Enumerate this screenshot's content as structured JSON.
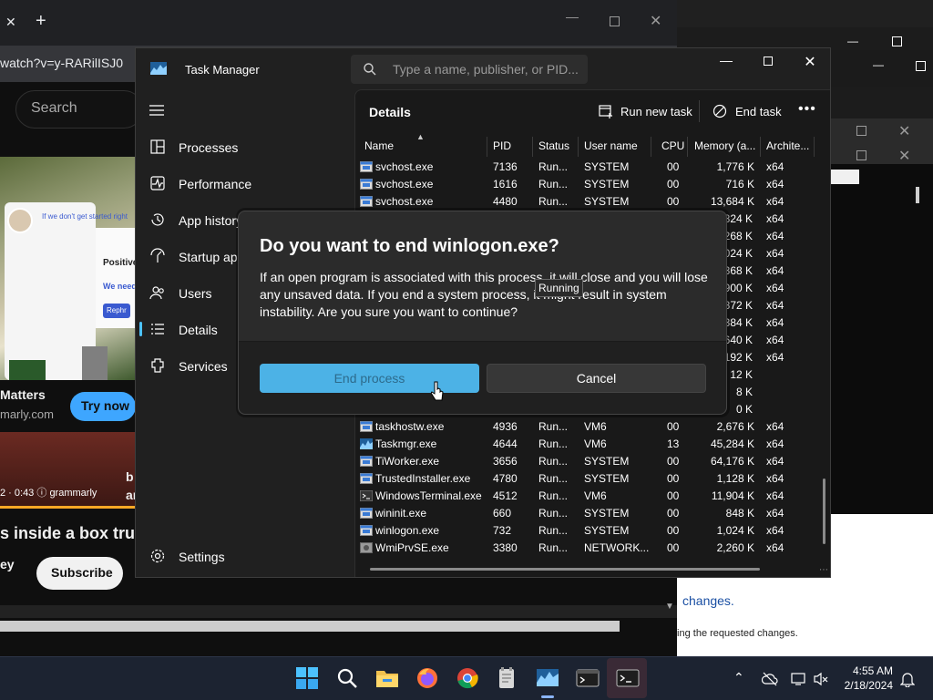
{
  "browser": {
    "new_tab_icon": "plus-icon",
    "url_fragment": "watch?v=y-RARilISJ0",
    "search_placeholder": "Search",
    "ad": {
      "card_text_1": "If we don't get started right",
      "card_text_2": "Positive",
      "card_text_3": "We need",
      "card_chip": "Rephr",
      "title": "Matters",
      "domain": "marly.com",
      "cta": "Try now",
      "time": "2 · 0:43",
      "advertiser": "grammarly",
      "overlay": "b\nar"
    },
    "video_title": "s inside a box tru",
    "channel": "ey",
    "subscribe": "Subscribe"
  },
  "update_panel": {
    "changes_link": "changes.",
    "description": "Windows needs to reboot your PC to finish installing the requested changes."
  },
  "task_manager": {
    "title": "Task Manager",
    "search_placeholder": "Type a name, publisher, or PID...",
    "nav": [
      {
        "label": "Processes",
        "icon": "processes-icon"
      },
      {
        "label": "Performance",
        "icon": "performance-icon"
      },
      {
        "label": "App history",
        "icon": "app-history-icon"
      },
      {
        "label": "Startup apps",
        "icon": "startup-apps-icon"
      },
      {
        "label": "Users",
        "icon": "users-icon"
      },
      {
        "label": "Details",
        "icon": "details-icon"
      },
      {
        "label": "Services",
        "icon": "services-icon"
      }
    ],
    "settings_label": "Settings",
    "page_title": "Details",
    "run_new_task": "Run new task",
    "end_task": "End task",
    "more": "•••",
    "columns": {
      "name": "Name",
      "pid": "PID",
      "status": "Status",
      "user": "User name",
      "cpu": "CPU",
      "memory": "Memory (a...",
      "arch": "Archite..."
    },
    "rows_top": [
      {
        "name": "svchost.exe",
        "pid": "7136",
        "status": "Run...",
        "user": "SYSTEM",
        "cpu": "00",
        "memory": "1,776 K",
        "arch": "x64"
      },
      {
        "name": "svchost.exe",
        "pid": "1616",
        "status": "Run...",
        "user": "SYSTEM",
        "cpu": "00",
        "memory": "716 K",
        "arch": "x64"
      },
      {
        "name": "svchost.exe",
        "pid": "4480",
        "status": "Run...",
        "user": "SYSTEM",
        "cpu": "00",
        "memory": "13,684 K",
        "arch": "x64"
      }
    ],
    "rows_partial": [
      {
        "memory": "824 K",
        "arch": "x64"
      },
      {
        "memory": "268 K",
        "arch": "x64"
      },
      {
        "memory": "024 K",
        "arch": "x64"
      },
      {
        "memory": "368 K",
        "arch": "x64"
      },
      {
        "memory": "900 K",
        "arch": "x64"
      },
      {
        "memory": "872 K",
        "arch": "x64"
      },
      {
        "memory": "384 K",
        "arch": "x64"
      },
      {
        "memory": "640 K",
        "arch": "x64"
      },
      {
        "memory": "192 K",
        "arch": "x64"
      },
      {
        "memory": "12 K",
        "arch": ""
      },
      {
        "memory": "8 K",
        "arch": ""
      },
      {
        "memory": "0 K",
        "arch": ""
      }
    ],
    "rows_bottom": [
      {
        "name": "taskhostw.exe",
        "pid": "4936",
        "status": "Run...",
        "user": "VM6",
        "cpu": "00",
        "memory": "2,676 K",
        "arch": "x64",
        "icon": "window-app-icon"
      },
      {
        "name": "Taskmgr.exe",
        "pid": "4644",
        "status": "Run...",
        "user": "VM6",
        "cpu": "13",
        "memory": "45,284 K",
        "arch": "x64",
        "icon": "task-manager-icon"
      },
      {
        "name": "TiWorker.exe",
        "pid": "3656",
        "status": "Run...",
        "user": "SYSTEM",
        "cpu": "00",
        "memory": "64,176 K",
        "arch": "x64",
        "icon": "window-app-icon"
      },
      {
        "name": "TrustedInstaller.exe",
        "pid": "4780",
        "status": "Run...",
        "user": "SYSTEM",
        "cpu": "00",
        "memory": "1,128 K",
        "arch": "x64",
        "icon": "window-app-icon"
      },
      {
        "name": "WindowsTerminal.exe",
        "pid": "4512",
        "status": "Run...",
        "user": "VM6",
        "cpu": "00",
        "memory": "11,904 K",
        "arch": "x64",
        "icon": "terminal-icon"
      },
      {
        "name": "wininit.exe",
        "pid": "660",
        "status": "Run...",
        "user": "SYSTEM",
        "cpu": "00",
        "memory": "848 K",
        "arch": "x64",
        "icon": "window-app-icon"
      },
      {
        "name": "winlogon.exe",
        "pid": "732",
        "status": "Run...",
        "user": "SYSTEM",
        "cpu": "00",
        "memory": "1,024 K",
        "arch": "x64",
        "icon": "window-app-icon"
      },
      {
        "name": "WmiPrvSE.exe",
        "pid": "3380",
        "status": "Run...",
        "user": "NETWORK...",
        "cpu": "00",
        "memory": "2,260 K",
        "arch": "x64",
        "icon": "wmi-icon"
      }
    ]
  },
  "dialog": {
    "title": "Do you want to end winlogon.exe?",
    "body": "If an open program is associated with this process, it will close and you will lose any unsaved data. If you end a system process, it might result in system instability. Are you sure you want to continue?",
    "primary": "End process",
    "secondary": "Cancel",
    "tooltip": "Running"
  },
  "taskbar": {
    "apps": [
      "start-icon",
      "search-icon",
      "file-explorer-icon",
      "firefox-icon",
      "chrome-icon",
      "notepad-icon",
      "task-manager-icon",
      "terminal-icon",
      "terminal-icon"
    ],
    "time": "4:55 AM",
    "date": "2/18/2024"
  },
  "colors": {
    "accent": "#4cc2ff",
    "primary_button": "#4cb2e6",
    "dialog_bg": "#2b2b2b",
    "taskbar_bg": "#1c2331"
  }
}
